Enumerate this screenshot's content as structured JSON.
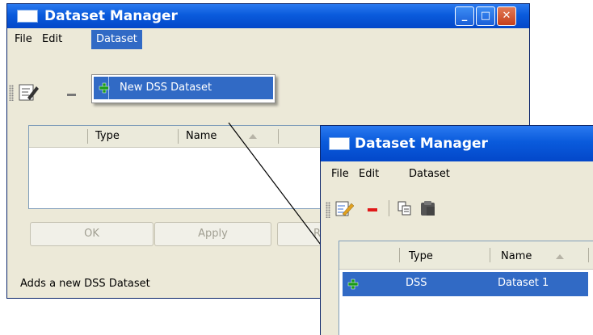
{
  "back_window": {
    "title": "Dataset Manager",
    "menu": [
      "File",
      "Edit",
      "Dataset"
    ],
    "dropdown_item": "New DSS Dataset",
    "columns": [
      "Type",
      "Name"
    ],
    "buttons": [
      "OK",
      "Apply",
      "R"
    ],
    "status": "Adds a new DSS Dataset"
  },
  "front_window": {
    "title": "Dataset Manager",
    "menu": [
      "File",
      "Edit",
      "Dataset"
    ],
    "columns": [
      "Type",
      "Name"
    ],
    "rows": [
      {
        "type": "DSS",
        "name": "Dataset 1"
      }
    ]
  },
  "colors": {
    "titlebar": "#0a5bdc",
    "selection": "#316ac5",
    "plus": "#1a9a1a",
    "minus": "#e01818"
  },
  "icons": [
    "grip-icon",
    "edit-icon",
    "remove-icon",
    "plus-icon",
    "copy-icon",
    "paste-icon",
    "sort-ascending-icon",
    "window-icon",
    "minimize-icon",
    "maximize-icon",
    "close-icon"
  ]
}
